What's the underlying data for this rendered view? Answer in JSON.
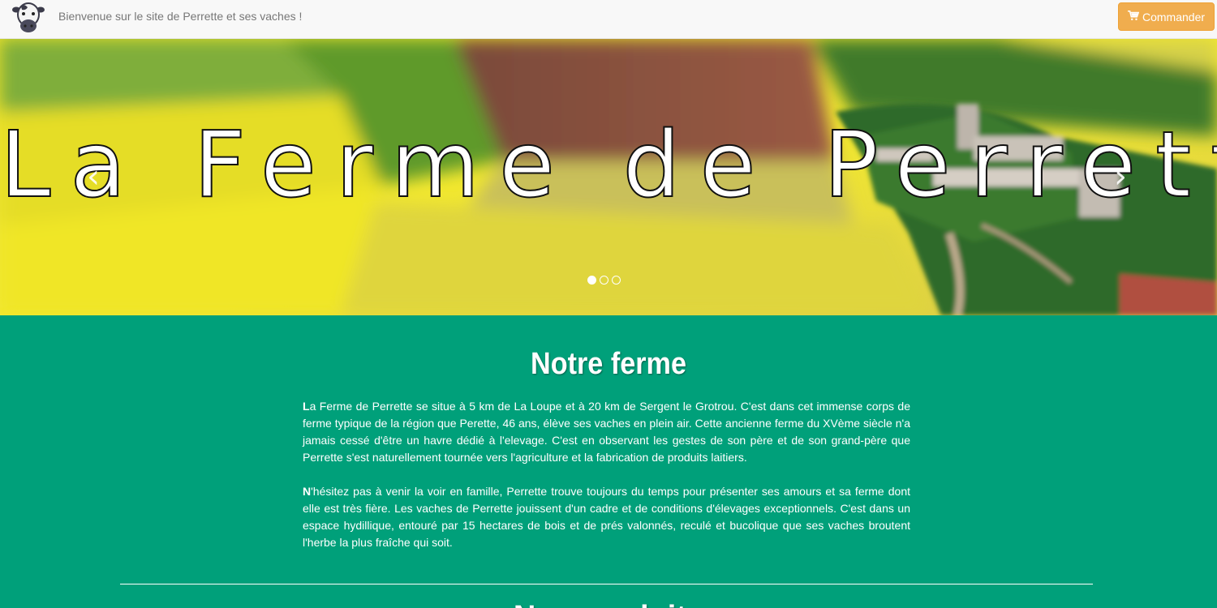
{
  "navbar": {
    "welcome_text": "Bienvenue sur le site de Perrette et ses vaches !",
    "order_button_label": "Commander",
    "order_icon": "shopping-cart-icon",
    "logo_icon": "cow-icon"
  },
  "carousel": {
    "title": "La Ferme de Perrette",
    "prev_icon": "chevron-left-icon",
    "next_icon": "chevron-right-icon",
    "prev_glyph": "‹",
    "next_glyph": "›",
    "slides_count": 3,
    "active_slide": 1
  },
  "main": {
    "section_title": "Notre ferme",
    "paragraphs": [
      {
        "initial": "L",
        "text": "a Ferme de Perrette se situe à 5 km de La Loupe et à 20 km de Sergent le Grotrou. C'est dans cet immense corps de ferme typique de la région que Perette, 46 ans, élève ses vaches en plein air. Cette ancienne ferme du XVème siècle n'a jamais cessé d'être un havre dédié à l'elevage. C'est en observant les gestes de son père et de son grand-père que Perrette s'est naturellement tournée vers l'agriculture et la fabrication de produits laitiers."
      },
      {
        "initial": "N",
        "text": "'hésitez pas à venir la voir en famille, Perrette trouve toujours du temps pour présenter ses amours et sa ferme dont elle est très fière. Les vaches de Perrette jouissent d'un cadre et de conditions d'élevages exceptionnels. C'est dans un espace hydillique, entouré par 15 hectares de bois et de prés valonnés, reculé et bucolique que ses vaches broutent l'herbe la plus fraîche qui soit."
      }
    ],
    "next_section_title": "Nos produits"
  },
  "colors": {
    "accent_green": "#00a07a",
    "button_orange": "#f0ad4e",
    "navbar_bg": "#f8f8f8"
  }
}
